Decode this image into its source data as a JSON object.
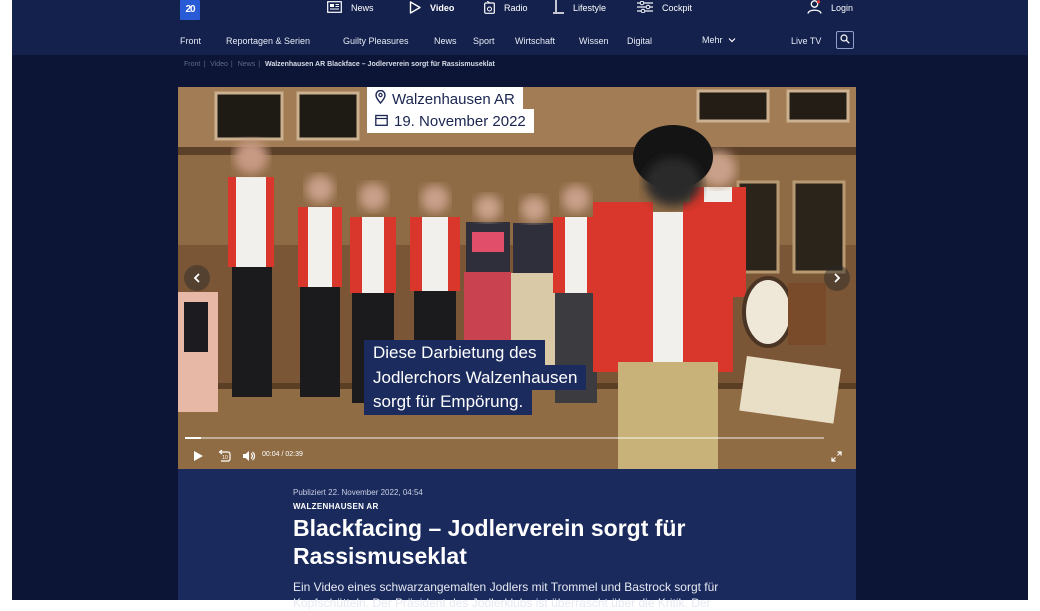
{
  "brand": {
    "logo_text": "20"
  },
  "top_nav": {
    "items": [
      {
        "label": "News",
        "icon": "newspaper-icon"
      },
      {
        "label": "Video",
        "icon": "play-icon",
        "active": true
      },
      {
        "label": "Radio",
        "icon": "radio-icon"
      },
      {
        "label": "Lifestyle",
        "icon": "lamp-icon"
      },
      {
        "label": "Cockpit",
        "icon": "sliders-icon"
      }
    ],
    "login_label": "Login"
  },
  "sub_nav": {
    "items": [
      "Front",
      "Reportagen & Serien",
      "Guilty Pleasures",
      "News",
      "Sport",
      "Wirtschaft",
      "Wissen",
      "Digital"
    ],
    "more_label": "Mehr",
    "live_label": "Live TV"
  },
  "breadcrumb": {
    "items": [
      "Front",
      "Video",
      "News"
    ],
    "current": "Walzenhausen AR Blackface – Jodlerverein sorgt für Rassismuseklat"
  },
  "video": {
    "location": "Walzenhausen AR",
    "date": "19. November 2022",
    "caption_lines": [
      "Diese Darbietung des",
      "Jodlerchors Walzenhausen",
      "sorgt für Empörung."
    ],
    "current_time": "00:04",
    "time_separator": "/",
    "duration": "02:39",
    "progress": 0.025
  },
  "article": {
    "published": "Publiziert 22. November 2022, 04:54",
    "kicker": "WALZENHAUSEN AR",
    "headline": "Blackfacing – Jodlerverein sorgt für Rassismuseklat",
    "lead": "Ein Video eines schwarzangemalten Jodlers mit Trommel und Bastrock sorgt für Kopfschütteln. Der Präsident des Jodlerklubs ist überrascht über die Kritik. Der"
  },
  "colors": {
    "page_bg": "#0c1535",
    "nav_bg": "#13214c",
    "article_bg": "#1a2a5c",
    "caption_bg": "#1b2b5d",
    "brand_blue": "#2a5bd7"
  }
}
